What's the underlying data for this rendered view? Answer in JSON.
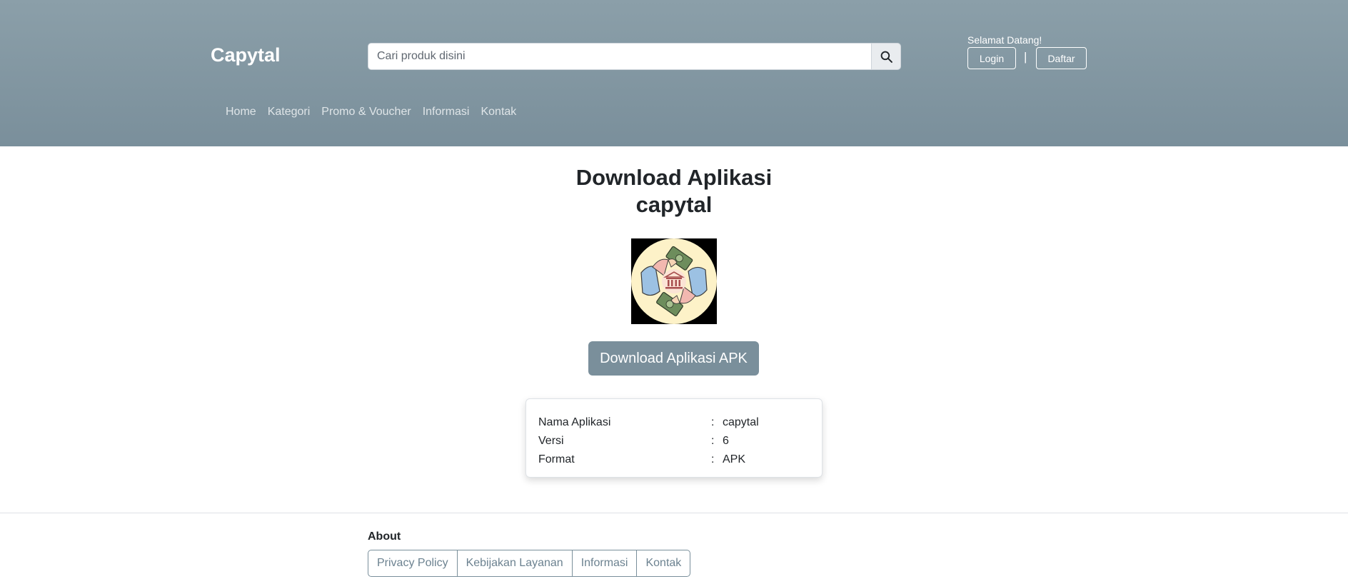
{
  "header": {
    "brand": "Capytal",
    "search": {
      "placeholder": "Cari produk disini",
      "value": ""
    },
    "welcome": "Selamat Datang!",
    "login_label": "Login",
    "separator": "|",
    "register_label": "Daftar",
    "nav": [
      {
        "label": "Home"
      },
      {
        "label": "Kategori"
      },
      {
        "label": "Promo & Voucher"
      },
      {
        "label": "Informasi"
      },
      {
        "label": "Kontak"
      }
    ]
  },
  "main": {
    "title_line1": "Download Aplikasi",
    "title_line2": "capytal",
    "download_label": "Download Aplikasi APK",
    "info": [
      {
        "label": "Nama Aplikasi",
        "colon": ":",
        "value": "capytal"
      },
      {
        "label": "Versi",
        "colon": ":",
        "value": "6"
      },
      {
        "label": "Format",
        "colon": ":",
        "value": "APK"
      }
    ]
  },
  "footer": {
    "about": "About",
    "links": [
      {
        "label": "Privacy Policy"
      },
      {
        "label": "Kebijakan Layanan"
      },
      {
        "label": "Informasi"
      },
      {
        "label": "Kontak"
      }
    ]
  },
  "icons": {
    "search": "search-icon",
    "logo": "bank-money-hands-logo"
  },
  "colors": {
    "header": "#8b9fa9",
    "accent": "#7a8f9b"
  }
}
